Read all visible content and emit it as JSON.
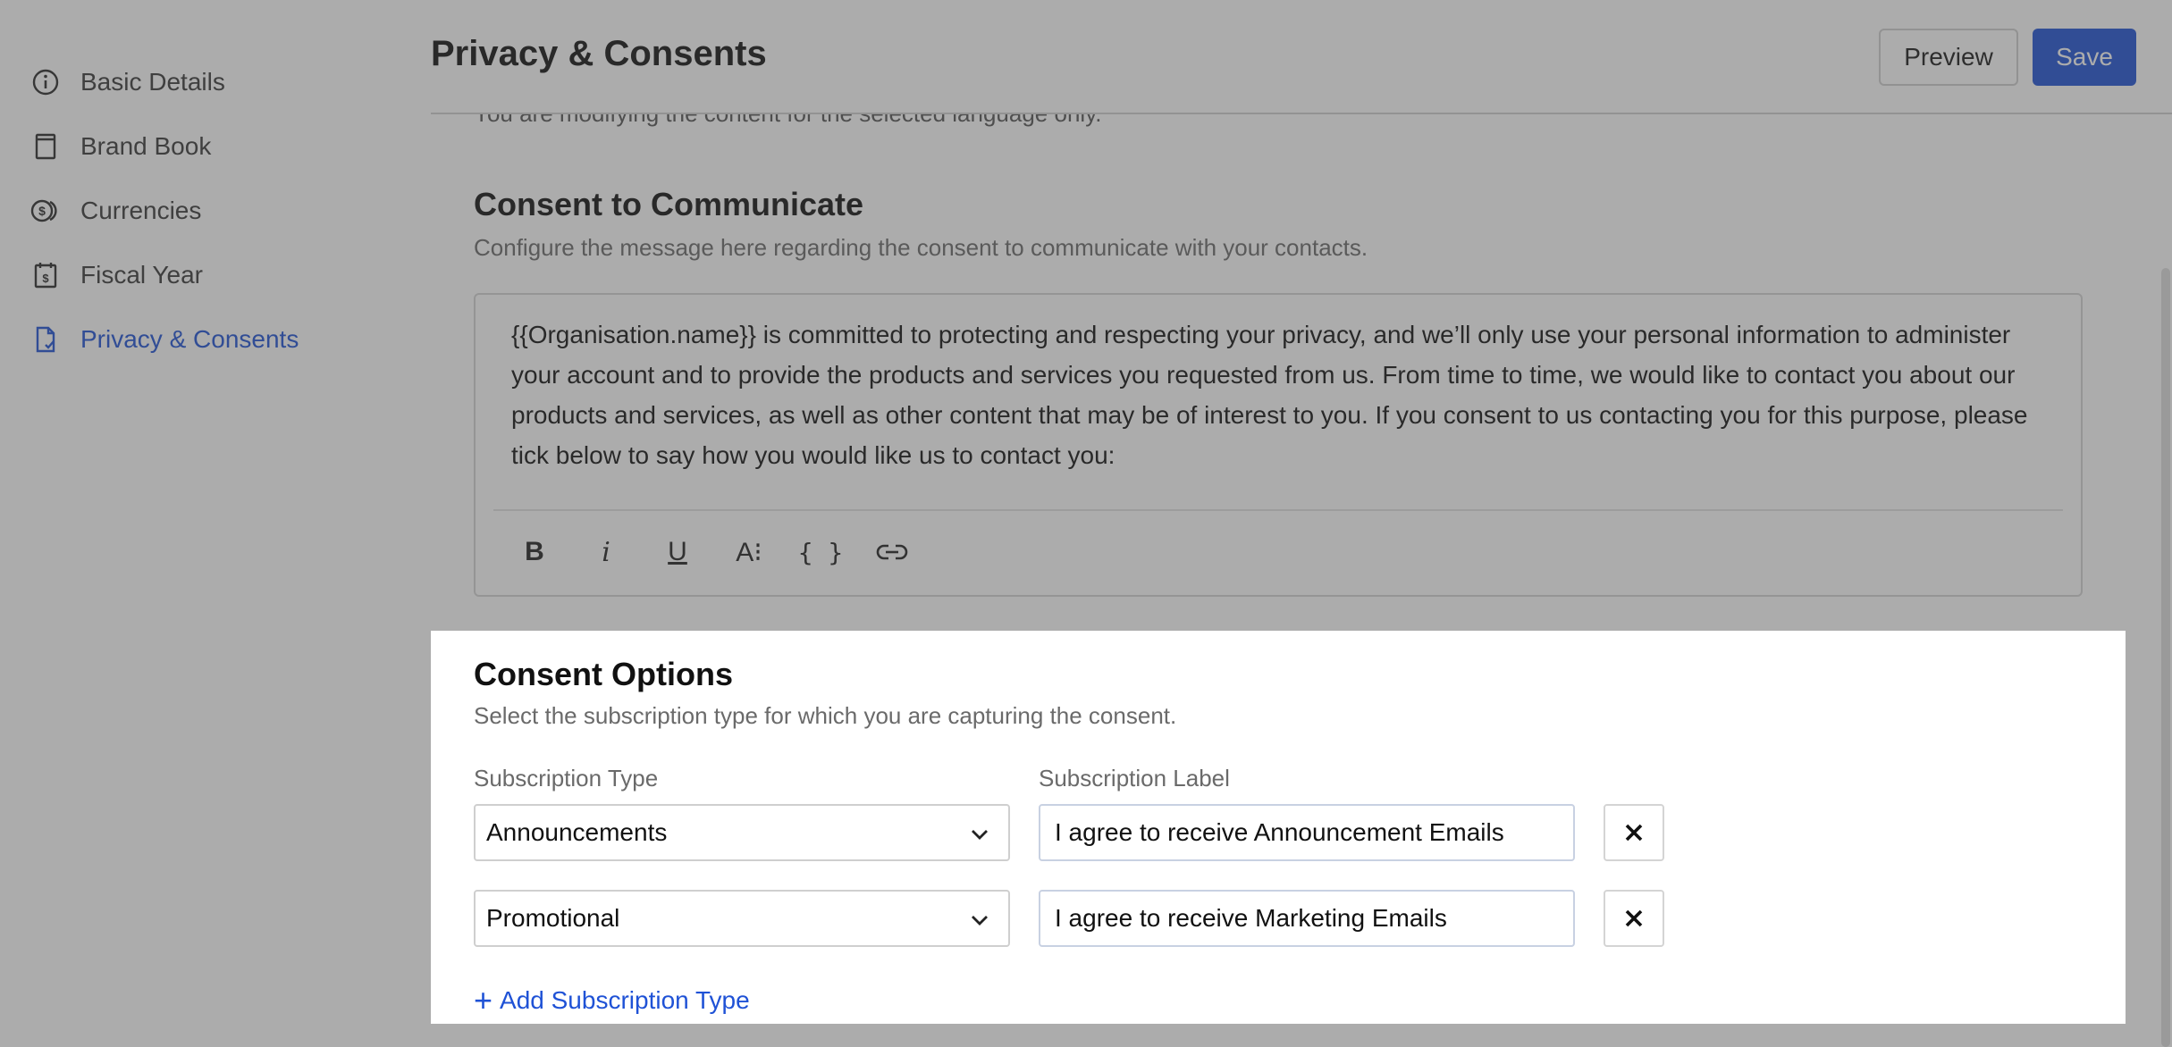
{
  "sidebar": {
    "items": [
      {
        "label": "Basic Details",
        "icon": "info-icon"
      },
      {
        "label": "Brand Book",
        "icon": "book-icon"
      },
      {
        "label": "Currencies",
        "icon": "currency-icon"
      },
      {
        "label": "Fiscal Year",
        "icon": "calendar-dollar-icon"
      },
      {
        "label": "Privacy & Consents",
        "icon": "document-check-icon",
        "active": true
      }
    ]
  },
  "header": {
    "title": "Privacy & Consents",
    "preview_label": "Preview",
    "save_label": "Save"
  },
  "language_note": "You are modifying the content for the selected language only.",
  "communicate": {
    "title": "Consent to Communicate",
    "subtitle": "Configure the message here regarding the consent to communicate with your contacts.",
    "body": "{{Organisation.name}} is committed to protecting and respecting your privacy, and we’ll only use your personal information to administer your account and to provide the products and services you requested from us. From time to time, we would like to contact you about our products and services, as well as other content that may be of interest to you. If you consent to us contacting you for this purpose, please tick below to say how you would like us to contact you:",
    "toolbar": {
      "bold": "B",
      "italic": "i",
      "underline": "U",
      "font_size": "A⁝",
      "variables": "{ }"
    }
  },
  "options": {
    "title": "Consent Options",
    "subtitle": "Select the subscription type for which you are capturing the consent.",
    "type_label": "Subscription Type",
    "label_label": "Subscription Label",
    "rows": [
      {
        "type": "Announcements",
        "label": "I agree to receive Announcement Emails"
      },
      {
        "type": "Promotional",
        "label": "I agree to receive Marketing Emails"
      }
    ],
    "add_label": "Add Subscription Type"
  },
  "colors": {
    "accent": "#1f52d6",
    "overlay": "#464646"
  }
}
